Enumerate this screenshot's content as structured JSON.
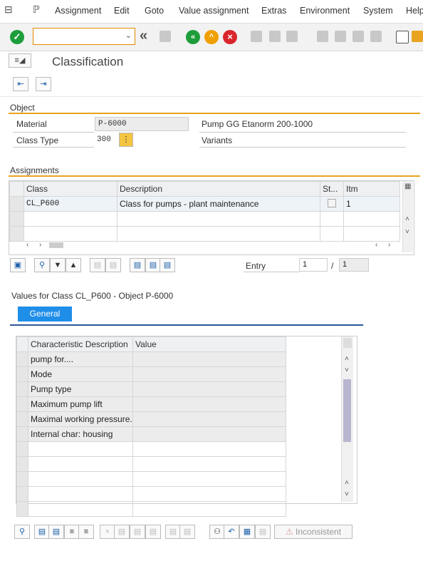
{
  "menu": [
    "Assignment",
    "Edit",
    "Goto",
    "Value assignment",
    "Extras",
    "Environment",
    "System",
    "Help"
  ],
  "toolbar": {
    "command_value": "",
    "icons": [
      "ok-icon",
      "back-nav-icon",
      "save-icon",
      "back-icon",
      "exit-icon",
      "cancel-icon",
      "print-icon",
      "find-icon",
      "find-next-icon",
      "first-page-icon",
      "prev-page-icon",
      "next-page-icon",
      "last-page-icon",
      "new-session-icon",
      "shortcut-icon"
    ]
  },
  "title": "Classification",
  "object": {
    "header": "Object",
    "material_label": "Material",
    "material_value": "P-6000",
    "material_desc": "Pump GG  Etanorm 200-1000",
    "class_type_label": "Class Type",
    "class_type_value": "300",
    "variants_label": "Variants"
  },
  "assignments": {
    "header": "Assignments",
    "columns": [
      "Class",
      "Description",
      "St...",
      "Itm"
    ],
    "rows": [
      {
        "class": "CL_P600",
        "description": "Class for pumps - plant maintenance",
        "status": "",
        "item": "1"
      }
    ],
    "entry_label": "Entry",
    "entry_value": "1",
    "entry_sep": "/",
    "entry_total": "1"
  },
  "values": {
    "header": "Values for Class CL_P600 - Object P-6000",
    "tab": "General",
    "columns": [
      "Characteristic Description",
      "Value"
    ],
    "rows": [
      "pump for....",
      "Mode",
      "Pump type",
      "Maximum pump lift",
      "Maximal working pressure...",
      "Internal char: housing"
    ],
    "inconsistent_label": "Inconsistent"
  },
  "colors": {
    "accent_rule": "#e9a321",
    "tab_blue": "#1f8ee8",
    "ok_green": "#1e9e3b",
    "cancel_red": "#d9262c",
    "exit_orange": "#f0a000"
  }
}
